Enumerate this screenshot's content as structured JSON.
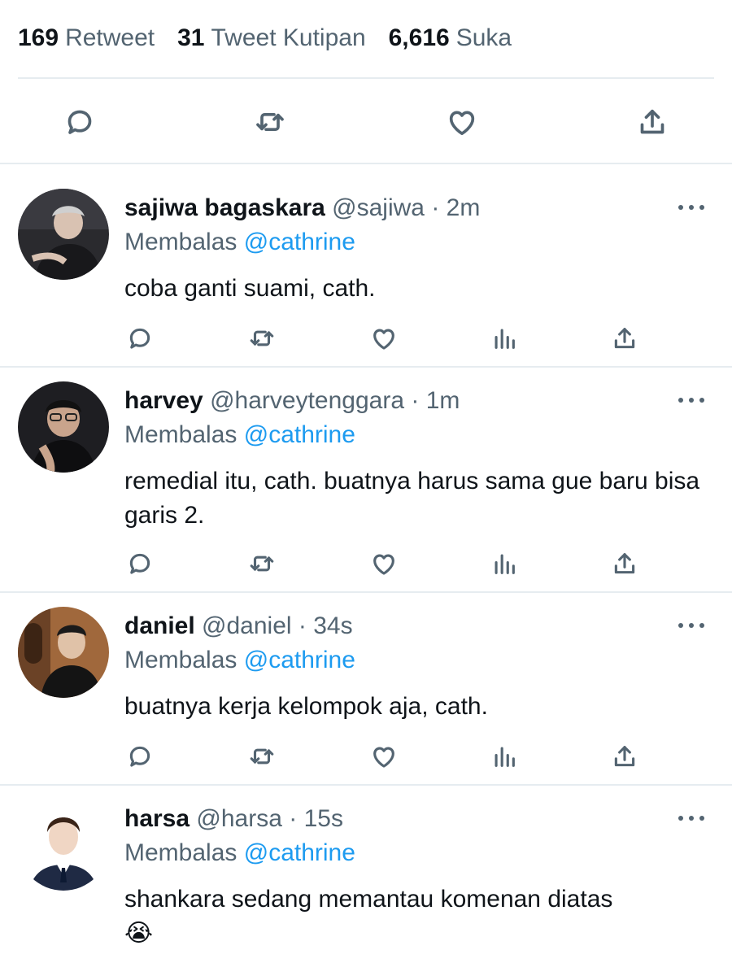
{
  "stats": {
    "retweets_count": "169",
    "retweets_label": "Retweet",
    "quotes_count": "31",
    "quotes_label": "Tweet Kutipan",
    "likes_count": "6,616",
    "likes_label": "Suka"
  },
  "colors": {
    "accent": "#1d9bf0",
    "muted": "#536471",
    "text": "#0f1419",
    "divider": "#e6ecf0"
  },
  "main_actions": [
    "reply-icon",
    "retweet-icon",
    "like-icon",
    "share-icon"
  ],
  "replies": [
    {
      "name": "sajiwa bagaskara",
      "handle": "@sajiwa",
      "time": "· 2m",
      "replying_label": "Membalas",
      "replying_to": "@cathrine",
      "text": "coba ganti suami, cath."
    },
    {
      "name": "harvey",
      "handle": "@harveytenggara",
      "time": "· 1m",
      "replying_label": "Membalas",
      "replying_to": "@cathrine",
      "text": "remedial itu, cath. buatnya harus sama gue baru bisa garis 2."
    },
    {
      "name": "daniel",
      "handle": "@daniel",
      "time": "· 34s",
      "replying_label": "Membalas",
      "replying_to": "@cathrine",
      "text": "buatnya kerja kelompok aja, cath."
    },
    {
      "name": "harsa",
      "handle": "@harsa",
      "time": "· 15s",
      "replying_label": "Membalas",
      "replying_to": "@cathrine",
      "text": "shankara sedang memantau komenan diatas",
      "emoji": "😭"
    }
  ]
}
